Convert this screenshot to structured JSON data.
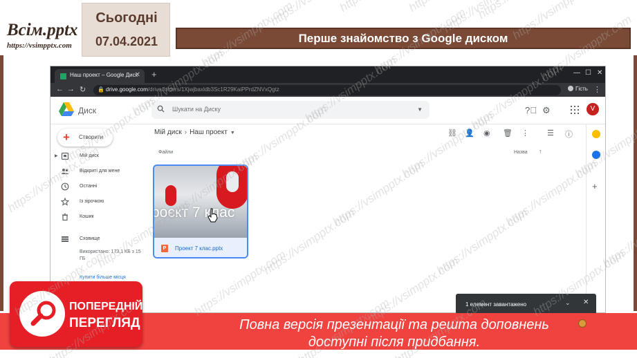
{
  "slide": {
    "brand_title": "Всім.pptx",
    "brand_url": "https://vsimpptx.com",
    "date_label": "Сьогодні",
    "date_value": "07.04.2021",
    "title": "Перше знайомство з Google диском",
    "watermark": "https://vsimpptx.com"
  },
  "browser": {
    "tab_title": "Наш проект – Google Диск",
    "tab_close": "✕",
    "new_tab": "+",
    "url_host": "drive.google.com",
    "url_path": "/drive/folders/1Xjwjbaxldb3Sc1R29KaiPPrdZNVxQgtz",
    "guest_label": "Гість"
  },
  "drive": {
    "app_name": "Диск",
    "search_placeholder": "Шукати на Диску",
    "avatar_letter": "V",
    "create_label": "Створити",
    "nav": [
      {
        "label": "Мій диск"
      },
      {
        "label": "Відкриті для мене"
      },
      {
        "label": "Останні"
      },
      {
        "label": "Із зірочкою"
      },
      {
        "label": "Кошик"
      },
      {
        "label": "Сховище"
      }
    ],
    "storage_text": "Використано: 173,1 КБ з 15 ГБ",
    "buy_link": "Купити більше місця",
    "breadcrumb_root": "Мій диск",
    "breadcrumb_current": "Наш проект",
    "files_label": "Файли",
    "sort_label": "Назва",
    "file": {
      "name": "Проект 7 клас.pptx",
      "thumb_text": "роєкт 7 клас",
      "type_letter": "P"
    },
    "upload_status": "1 елемент завантажено"
  },
  "banner": {
    "line1": "Повна версія презентації та решта доповнень",
    "line2": "доступні після придбання.",
    "badge_line1": "ПОПЕРЕДНІЙ",
    "badge_line2": "ПЕРЕГЛЯД"
  },
  "colors": {
    "brown": "#7a4a37",
    "banner_red": "#f0423f",
    "badge_red": "#e61f26",
    "drive_blue": "#1a73e8",
    "avatar_red": "#c5221f"
  }
}
